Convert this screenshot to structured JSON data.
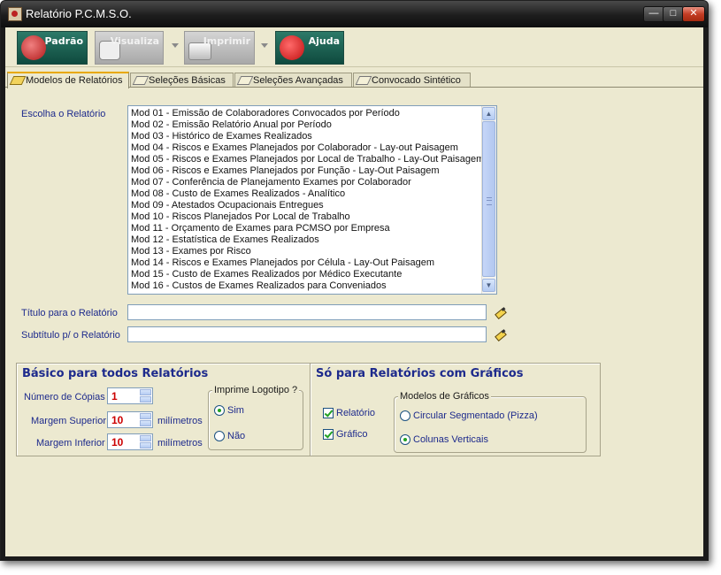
{
  "window": {
    "title": "Relatório P.C.M.S.O.",
    "controls": {
      "minimize": "—",
      "maximize": "□",
      "close": "✕"
    }
  },
  "toolbar": {
    "buttons": [
      {
        "label": "Padrão",
        "icon": "report-magnifier-icon",
        "enabled": true
      },
      {
        "label": "Visualiza",
        "icon": "camera-icon",
        "enabled": false
      },
      {
        "label": "Imprimir",
        "icon": "printer-icon",
        "enabled": false
      },
      {
        "label": "Ajuda",
        "icon": "help-icon",
        "enabled": true
      }
    ]
  },
  "tabs": [
    {
      "label": "Modelos de Relatórios",
      "active": true
    },
    {
      "label": "Seleções Básicas",
      "active": false
    },
    {
      "label": "Seleções Avançadas",
      "active": false
    },
    {
      "label": "Convocado Sintético",
      "active": false
    }
  ],
  "report_list": {
    "label": "Escolha o Relatório",
    "items": [
      "Mod 01 - Emissão de Colaboradores Convocados por Período",
      "Mod 02 - Emissão Relatório Anual por Período",
      "Mod 03 - Histórico de Exames Realizados",
      "Mod 04 - Riscos e Exames Planejados por Colaborador - Lay-out Paisagem",
      "Mod 05 - Riscos e Exames Planejados por Local de Trabalho - Lay-Out Paisagem",
      "Mod 06 - Riscos e Exames Planejados por Função - Lay-Out Paisagem",
      "Mod 07 - Conferência de Planejamento Exames por Colaborador",
      "Mod 08 - Custo de Exames Realizados - Analítico",
      "Mod 09 - Atestados Ocupacionais Entregues",
      "Mod 10 - Riscos Planejados Por Local de Trabalho",
      "Mod 11 - Orçamento de Exames para PCMSO por Empresa",
      "Mod 12 - Estatística de Exames Realizados",
      "Mod 13 - Exames por Risco",
      "Mod 14 - Riscos e Exames Planejados por Célula - Lay-Out Paisagem",
      "Mod 15 - Custo de Exames Realizados por Médico Executante",
      "Mod 16 - Custos de Exames Realizados para Conveniados"
    ]
  },
  "title_field": {
    "label": "Título para o Relatório",
    "value": ""
  },
  "subtitle_field": {
    "label": "Subtítulo  p/ o Relatório",
    "value": ""
  },
  "basic_group": {
    "title": "Básico para todos Relatórios",
    "copies": {
      "label": "Número de Cópias",
      "value": "1"
    },
    "margin_top": {
      "label": "Margem Superior",
      "value": "10",
      "unit": "milímetros"
    },
    "margin_bottom": {
      "label": "Margem Inferior",
      "value": "10",
      "unit": "milímetros"
    },
    "logo": {
      "title": "Imprime Logotipo ?",
      "yes": "Sim",
      "no": "Não",
      "selected": "Sim"
    }
  },
  "charts_group": {
    "title": "Só para Relatórios com Gráficos",
    "report_check": {
      "label": "Relatório",
      "checked": true
    },
    "chart_check": {
      "label": "Gráfico",
      "checked": true
    },
    "models": {
      "title": "Modelos de Gráficos",
      "pie": "Circular Segmentado (Pizza)",
      "columns": "Colunas Verticais",
      "selected": "Colunas Verticais"
    }
  },
  "colors": {
    "accent": "#1d2a8c",
    "value_red": "#cc0000",
    "panel": "#ece9d0"
  }
}
